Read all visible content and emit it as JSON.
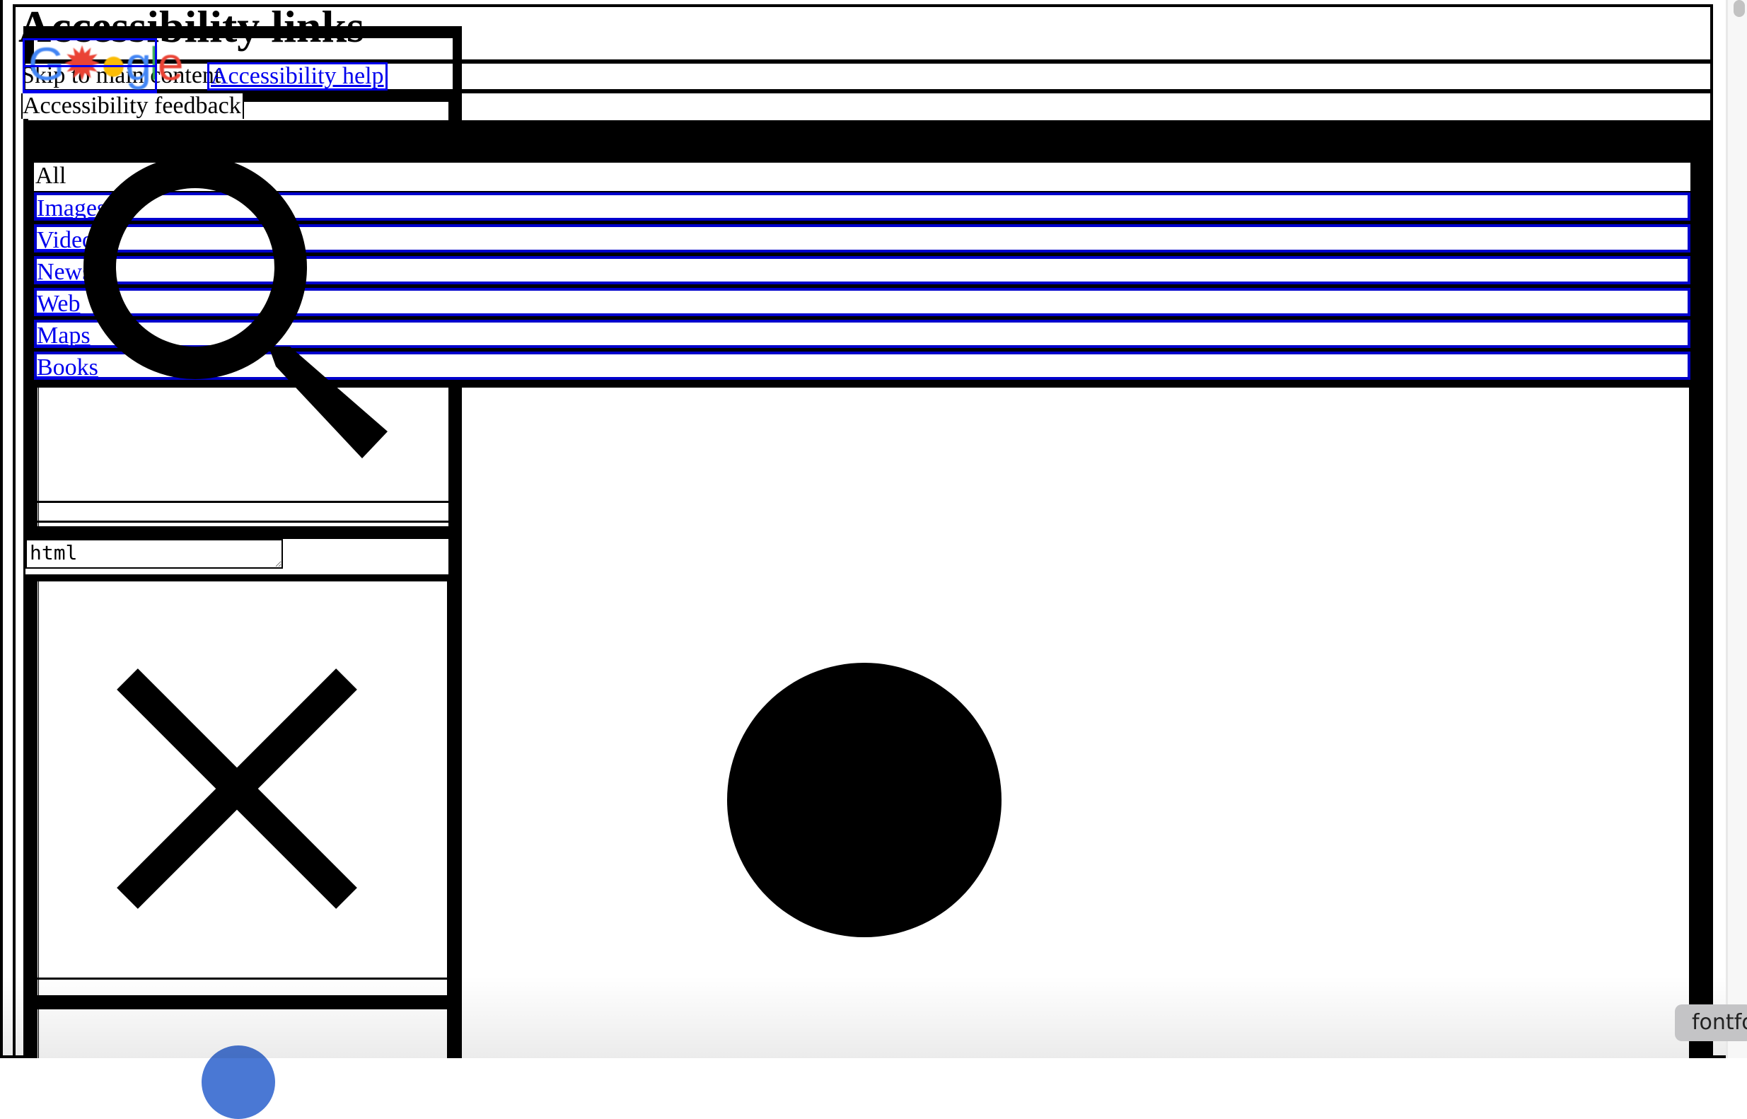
{
  "page": {
    "heading": "Accessibility links",
    "logo_text": "Google",
    "logo_colors": [
      "#4285f4",
      "#ea4335",
      "#fbbc05",
      "#4285f4",
      "#34a853",
      "#ea4335"
    ]
  },
  "accessibility_links": {
    "skip_to_main": "Skip to main content",
    "help": "Accessibility help",
    "feedback": "Accessibility feedback"
  },
  "nav": {
    "items": [
      {
        "label": "All",
        "active": true
      },
      {
        "label": "Images",
        "active": false
      },
      {
        "label": "Videos",
        "active": false
      },
      {
        "label": "News",
        "active": false
      },
      {
        "label": "Web",
        "active": false
      },
      {
        "label": "Maps",
        "active": false
      },
      {
        "label": "Books",
        "active": false
      }
    ]
  },
  "search": {
    "query": "html"
  },
  "icons": {
    "search": "search-icon",
    "clear": "close-icon",
    "record": "circle-icon",
    "voice": "voice-search-icon"
  },
  "tooltip": {
    "text": "fontfo"
  },
  "colors": {
    "link": "#0000ee",
    "link_border": "#0000cc",
    "voice_blue": "#4a78d4",
    "tooltip_bg": "#c4c4c6"
  }
}
